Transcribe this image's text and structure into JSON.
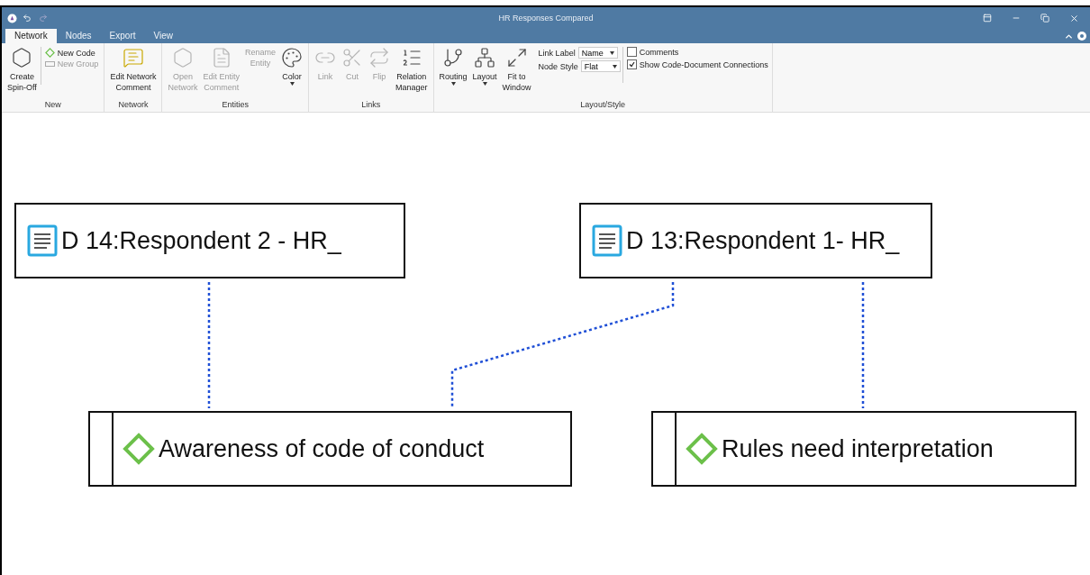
{
  "window": {
    "title": "HR Responses Compared"
  },
  "tabs": [
    {
      "label": "Network",
      "selected": true
    },
    {
      "label": "Nodes",
      "selected": false
    },
    {
      "label": "Export",
      "selected": false
    },
    {
      "label": "View",
      "selected": false
    }
  ],
  "ribbon": [
    {
      "label": "New",
      "items": [
        {
          "kind": "large",
          "lines": [
            "Create",
            "Spin-Off"
          ],
          "disabled": false
        },
        {
          "kind": "stack",
          "items": [
            {
              "kind": "small",
              "label": "New Code",
              "disabled": false
            },
            {
              "kind": "small",
              "label": "New Group",
              "disabled": true
            }
          ]
        }
      ]
    },
    {
      "label": "Network",
      "items": [
        {
          "kind": "large",
          "lines": [
            "Edit Network",
            "Comment"
          ],
          "disabled": false
        }
      ]
    },
    {
      "label": "Entities",
      "items": [
        {
          "kind": "large",
          "lines": [
            "Open",
            "Network"
          ],
          "disabled": true
        },
        {
          "kind": "large",
          "lines": [
            "Edit Entity",
            "Comment"
          ],
          "disabled": true
        },
        {
          "kind": "large",
          "lines": [
            "Rename",
            "Entity"
          ],
          "disabled": true
        },
        {
          "kind": "large",
          "lines": [
            "Color"
          ],
          "dropdown": true,
          "disabled": false
        }
      ]
    },
    {
      "label": "Links",
      "items": [
        {
          "kind": "large",
          "lines": [
            "Link"
          ],
          "disabled": true
        },
        {
          "kind": "large",
          "lines": [
            "Cut"
          ],
          "disabled": true
        },
        {
          "kind": "large",
          "lines": [
            "Flip"
          ],
          "disabled": true
        },
        {
          "kind": "large",
          "lines": [
            "Relation",
            "Manager"
          ],
          "disabled": false
        }
      ]
    },
    {
      "label": "Layout/Style",
      "items": [
        {
          "kind": "large",
          "lines": [
            "Routing"
          ],
          "dropdown": true,
          "disabled": false
        },
        {
          "kind": "large",
          "lines": [
            "Layout"
          ],
          "dropdown": true,
          "disabled": false
        },
        {
          "kind": "large",
          "lines": [
            "Fit to",
            "Window"
          ],
          "disabled": false
        },
        {
          "kind": "selects",
          "items": [
            {
              "label": "Link Label",
              "value": "Name"
            },
            {
              "label": "Node Style",
              "value": "Flat"
            }
          ]
        },
        {
          "kind": "checks",
          "items": [
            {
              "label": "Comments",
              "checked": false
            },
            {
              "label": "Show Code-Document Connections",
              "checked": true
            }
          ]
        }
      ]
    }
  ],
  "nodes": [
    {
      "kind": "document",
      "label": "D 14:Respondent 2 - HR_"
    },
    {
      "kind": "document",
      "label": "D 13:Respondent 1- HR_"
    },
    {
      "kind": "code",
      "label": "Awareness of code of conduct"
    },
    {
      "kind": "code",
      "label": "Rules need interpretation"
    }
  ]
}
